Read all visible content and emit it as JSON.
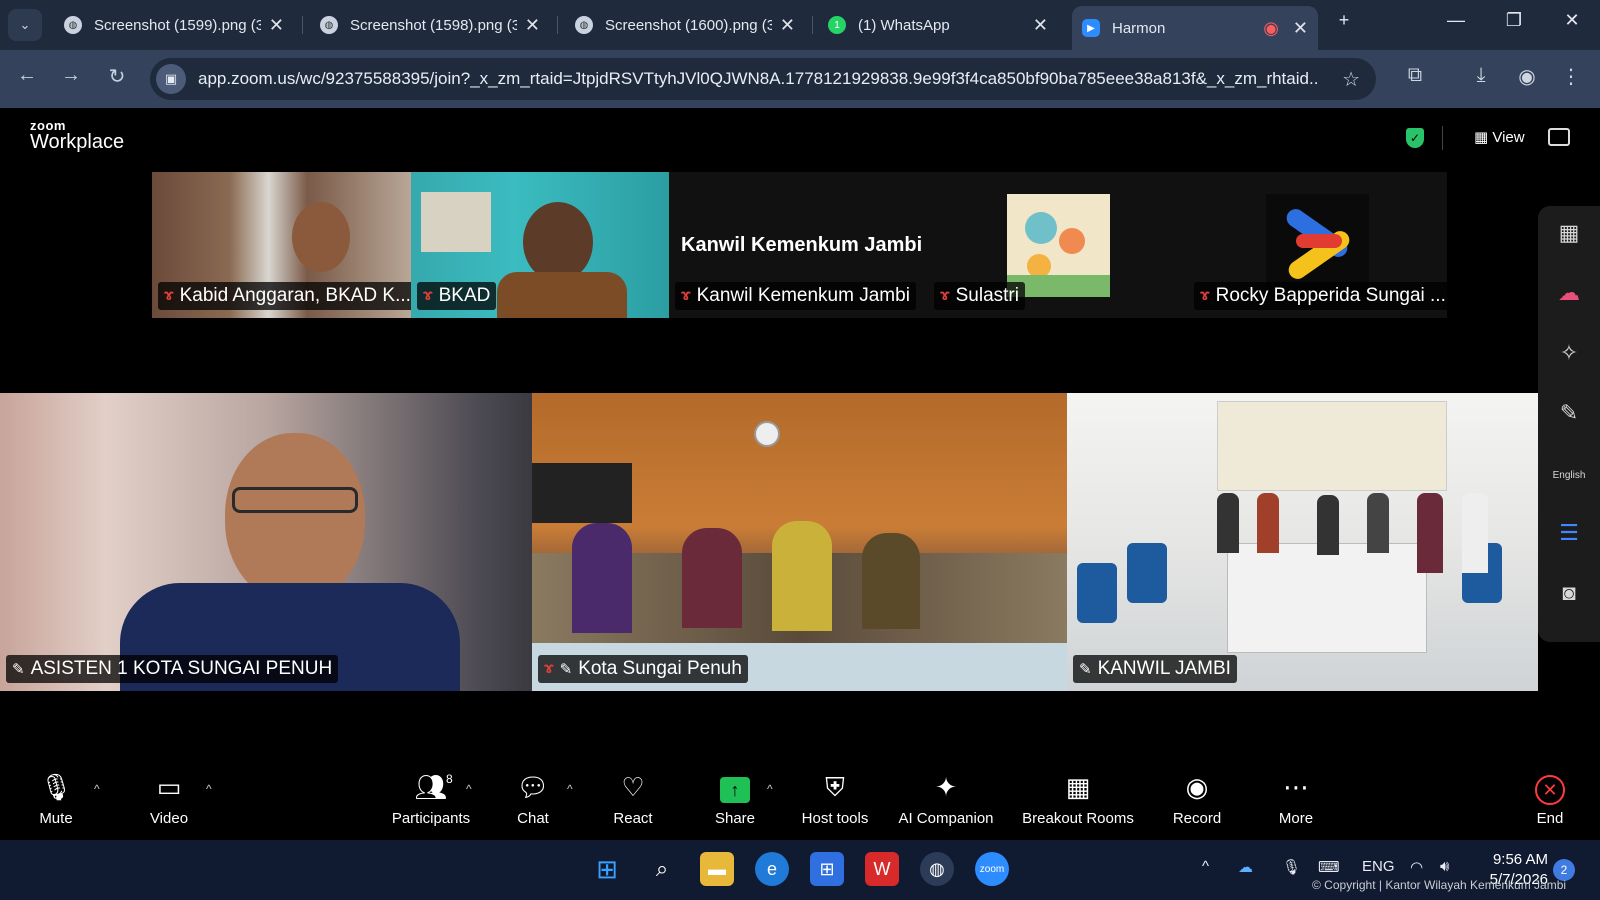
{
  "browser": {
    "tabs": [
      {
        "label": "Screenshot (1599).png (3",
        "icon": "globe-icon"
      },
      {
        "label": "Screenshot (1598).png (3",
        "icon": "globe-icon"
      },
      {
        "label": "Screenshot (1600).png (3",
        "icon": "globe-icon"
      },
      {
        "label": "(1) WhatsApp",
        "icon": "whatsapp-icon",
        "badge": "1"
      },
      {
        "label": "Harmon",
        "icon": "zoom-icon"
      }
    ],
    "url": "app.zoom.us/wc/92375588395/join?_x_zm_rtaid=JtpjdRSVTtyhJVl0QJWN8A.1778121929838.9e99f3f4ca850bf90ba785eee38a813f&_x_zm_rhtaid..."
  },
  "zoom": {
    "brand_top": "zoom",
    "brand_bottom": "Workplace",
    "view_label": "View",
    "thumbnails": [
      {
        "name": "Kabid Anggaran, BKAD K...",
        "muted": true
      },
      {
        "name": "BKAD",
        "muted": true
      },
      {
        "name": "Kanwil Kemenkum Jambi",
        "title": "Kanwil Kemenkum Jambi",
        "muted": true
      },
      {
        "name": "Sulastri",
        "muted": true
      },
      {
        "name": "Rocky Bapperida Sungai ...",
        "muted": true
      }
    ],
    "tiles": [
      {
        "name": "ASISTEN 1 KOTA SUNGAI PENUH",
        "muted": false,
        "pinned": true,
        "speaking": true
      },
      {
        "name": "Kota Sungai Penuh",
        "muted": true,
        "pinned": true,
        "speaking": false
      },
      {
        "name": "KANWIL JAMBI",
        "muted": false,
        "pinned": true,
        "speaking": false
      }
    ],
    "side_panel": {
      "language_label": "English"
    },
    "controls": {
      "mute": "Mute",
      "video": "Video",
      "participants": "Participants",
      "participants_count": "8",
      "chat": "Chat",
      "react": "React",
      "share": "Share",
      "host_tools": "Host tools",
      "ai_companion": "AI Companion",
      "breakout_rooms": "Breakout Rooms",
      "record": "Record",
      "more": "More",
      "end": "End"
    }
  },
  "taskbar": {
    "language": "ENG",
    "time": "9:56 AM",
    "date": "5/7/2026",
    "notification_count": "2"
  },
  "watermark": "© Copyright | Kantor Wilayah Kemenkum Jambi",
  "colors": {
    "speaking_border": "#3cc25c",
    "share_green": "#1fc157",
    "end_red": "#ff3b3b",
    "muted_red": "#e0403a"
  }
}
